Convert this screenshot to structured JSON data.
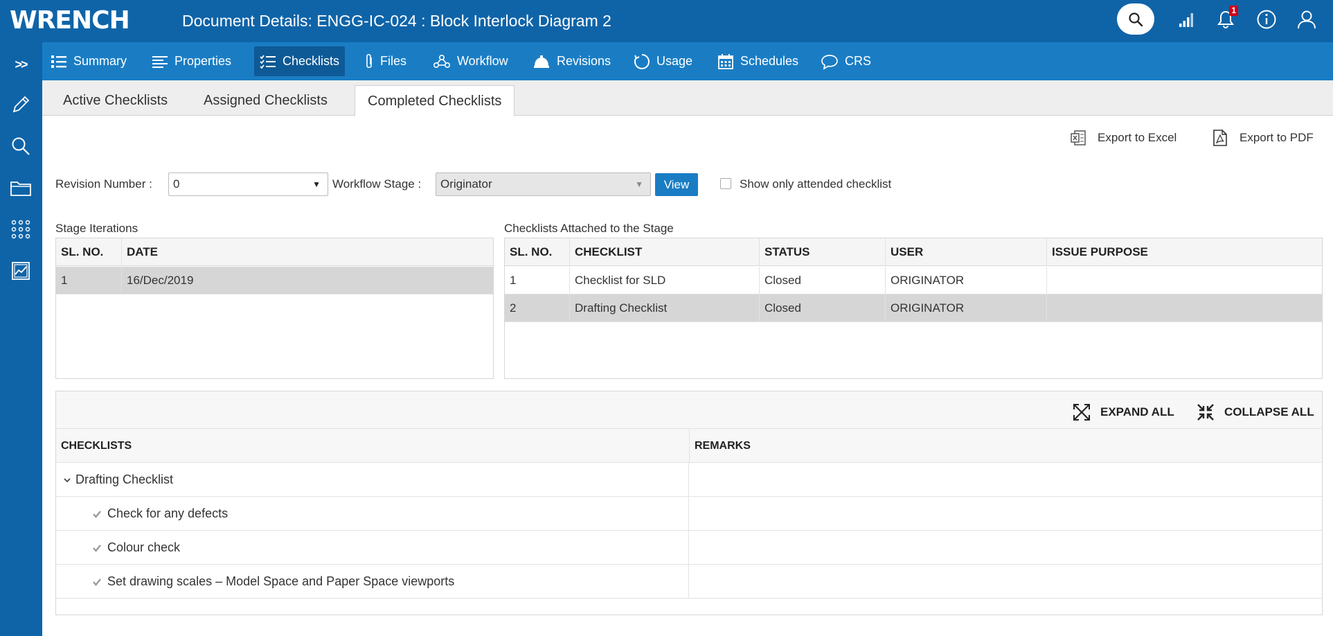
{
  "header": {
    "logo": "WRENCH",
    "title": "Document Details: ENGG-IC-024 : Block Interlock Diagram 2",
    "notifications_count": "1",
    "icons": [
      "search-icon",
      "signal-icon",
      "bell-icon",
      "info-icon",
      "user-icon"
    ]
  },
  "siderail": {
    "expand": ">>",
    "icons": [
      "pencil-icon",
      "search-icon",
      "folder-icon",
      "apps-grid-icon",
      "report-icon"
    ]
  },
  "nav": {
    "summary": "Summary",
    "properties": "Properties",
    "checklists": "Checklists",
    "files": "Files",
    "workflow": "Workflow",
    "revisions": "Revisions",
    "usage": "Usage",
    "schedules": "Schedules",
    "crs": "CRS",
    "active": "Checklists"
  },
  "tabs": {
    "active_checklists": "Active Checklists",
    "assigned_checklists": "Assigned Checklists",
    "completed_checklists": "Completed Checklists",
    "selected": "Completed Checklists"
  },
  "export": {
    "excel": "Export to Excel",
    "pdf": "Export to PDF"
  },
  "filters": {
    "revision_label": "Revision Number :",
    "revision_value": "0",
    "stage_label": "Workflow Stage :",
    "stage_value": "Originator",
    "view_button": "View",
    "attended_label": "Show only attended checklist",
    "attended_checked": false
  },
  "stage_iterations": {
    "caption": "Stage Iterations",
    "columns": [
      "SL. NO.",
      "DATE"
    ],
    "rows": [
      {
        "sl": "1",
        "date": "16/Dec/2019",
        "selected": true
      }
    ]
  },
  "attached_checklists": {
    "caption": "Checklists Attached to the Stage",
    "columns": [
      "SL. NO.",
      "CHECKLIST",
      "STATUS",
      "USER",
      "ISSUE PURPOSE"
    ],
    "rows": [
      {
        "sl": "1",
        "checklist": "Checklist for SLD",
        "status": "Closed",
        "user": "ORIGINATOR",
        "issue_purpose": "",
        "selected": false
      },
      {
        "sl": "2",
        "checklist": "Drafting Checklist",
        "status": "Closed",
        "user": "ORIGINATOR",
        "issue_purpose": "",
        "selected": true
      }
    ]
  },
  "tree": {
    "expand_all": "EXPAND ALL",
    "collapse_all": "COLLAPSE ALL",
    "col_checklists": "CHECKLISTS",
    "col_remarks": "REMARKS",
    "group": "Drafting Checklist",
    "items": [
      {
        "label": "Check for any defects",
        "checked": true,
        "remarks": ""
      },
      {
        "label": "Colour check",
        "checked": true,
        "remarks": ""
      },
      {
        "label": "Set drawing scales – Model Space and Paper Space viewports",
        "checked": true,
        "remarks": ""
      }
    ]
  },
  "colors": {
    "primary": "#0f64a8",
    "nav": "#1a7dc4",
    "nav_active": "#0d5a96",
    "badge": "#d0021b",
    "selected_row": "#d6d6d6"
  }
}
